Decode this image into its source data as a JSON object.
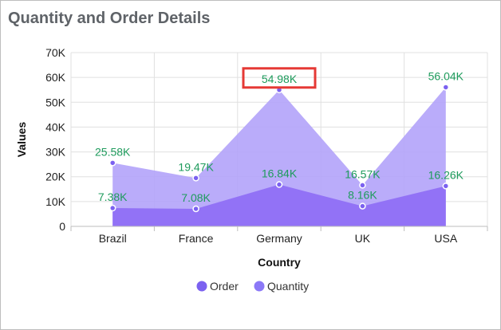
{
  "header": {
    "title": "Quantity and Order Details"
  },
  "chart_data": {
    "type": "area",
    "categories": [
      "Brazil",
      "France",
      "Germany",
      "UK",
      "USA"
    ],
    "series": [
      {
        "name": "Order",
        "values": [
          7380,
          7080,
          16840,
          8160,
          16260
        ],
        "labels": [
          "7.38K",
          "7.08K",
          "16.84K",
          "8.16K",
          "16.26K"
        ],
        "color": "#8e6cf5"
      },
      {
        "name": "Quantity",
        "values": [
          25580,
          19470,
          54980,
          16570,
          56040
        ],
        "labels": [
          "25.58K",
          "19.47K",
          "54.98K",
          "16.57K",
          "56.04K"
        ],
        "color": "#b3a3fa"
      }
    ],
    "xlabel": "Country",
    "ylabel": "Values",
    "ylim": [
      0,
      70000
    ],
    "yticks": [
      0,
      10000,
      20000,
      30000,
      40000,
      50000,
      60000,
      70000
    ],
    "ytick_labels": [
      "0",
      "10K",
      "20K",
      "30K",
      "40K",
      "50K",
      "60K",
      "70K"
    ],
    "grid": true,
    "legend_position": "bottom",
    "highlight": {
      "series": "Quantity",
      "category": "Germany",
      "color": "#e53935"
    },
    "colors": {
      "label_text": "#1e9b5c",
      "marker": "#7b61f0",
      "grid": "#e0e0e0"
    }
  }
}
